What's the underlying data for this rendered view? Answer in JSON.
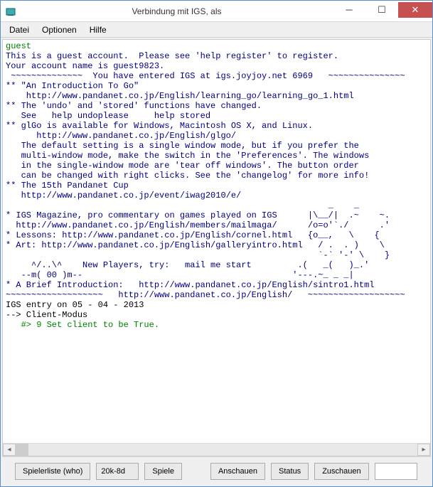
{
  "window": {
    "title": "Verbindung mit IGS, als"
  },
  "menu": {
    "file": "Datei",
    "options": "Optionen",
    "help": "Hilfe"
  },
  "terminal": {
    "l01": "guest",
    "l02": "This is a guest account.  Please see 'help register' to register.",
    "l03": "Your account name is guest9823.",
    "l04": " ~~~~~~~~~~~~~~  You have entered IGS at igs.joyjoy.net 6969   ~~~~~~~~~~~~~~~",
    "l05": "** \"An Introduction To Go\"",
    "l06": "    http://www.pandanet.co.jp/English/learning_go/learning_go_1.html",
    "l07": "** The 'undo' and 'stored' functions have changed.",
    "l08": "   See   help undoplease     help stored",
    "l09": "** glGo is available for Windows, Macintosh OS X, and Linux.",
    "l10": "      http://www.pandanet.co.jp/English/glgo/",
    "l11": "   The default setting is a single window mode, but if you prefer the",
    "l12": "   multi-window mode, make the switch in the 'Preferences'. The windows",
    "l13": "   in the single-window mode are 'tear off windows'. The button order",
    "l14": "   can be changed with right clicks. See the 'changelog' for more info!",
    "l15": "** The 15th Pandanet Cup",
    "l16": "   http://www.pandanet.co.jp/event/iwag2010/e/",
    "l17": "                                                               _    _",
    "l18": "* IGS Magazine, pro commentary on games played on IGS      |\\__/|  .~    ~.",
    "l19": "  http://www.pandanet.co.jp/English/members/mailmaga/      /o=o'`./      .'",
    "l20": "* Lessons: http://www.pandanet.co.jp/English/cornel.html   {o__,   \\    {",
    "l21": "* Art: http://www.pandanet.co.jp/English/galleryintro.html   / .  . )    \\",
    "l22": "                                                             `-` '-' \\    }",
    "l23": "     ^/..\\^    New Players, try:   mail me start         .(   _(   )_.'",
    "l24": "   --m( 00 )m--                                         '---.~_ _ _|",
    "l25": "* A Brief Introduction:   http://www.pandanet.co.jp/English/sintro1.html",
    "l26": "~~~~~~~~~~~~~~~~~~~   http://www.pandanet.co.jp/English/   ~~~~~~~~~~~~~~~~~~~",
    "l27": "IGS entry on 05 - 04 - 2013",
    "l28": "--> Client-Modus",
    "l29": "   #> 9 Set client to be True."
  },
  "buttons": {
    "playerlist": "Spielerliste (who)",
    "rank": "20k-8d",
    "games": "Spiele",
    "observe": "Anschauen",
    "status": "Status",
    "watch": "Zuschauen"
  }
}
